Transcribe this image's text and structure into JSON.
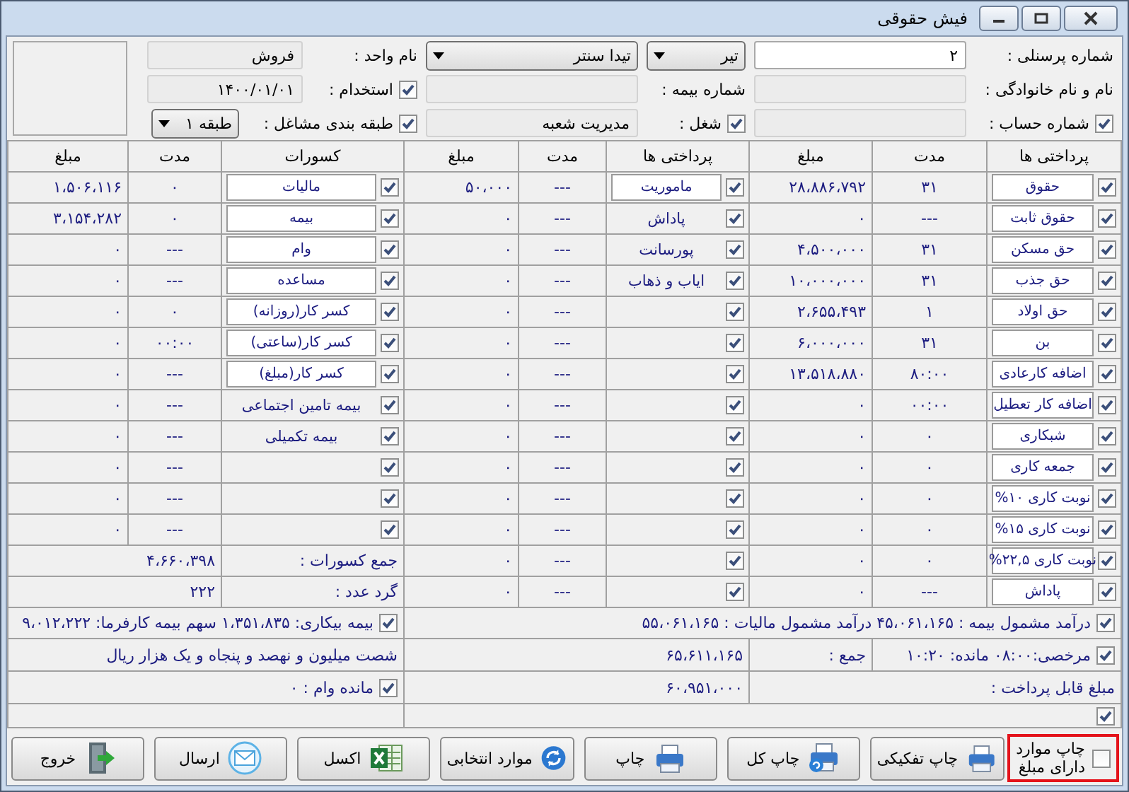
{
  "window": {
    "title": "فیش حقوقی"
  },
  "header": {
    "personnel_no": {
      "label": "شماره پرسنلی :",
      "value": "۲",
      "disabled": false
    },
    "month": {
      "value": "تیر"
    },
    "company": {
      "value": "تیدا سنتر"
    },
    "unit": {
      "label": "نام واحد :",
      "value": "فروش",
      "disabled": true
    },
    "full_name": {
      "label": "نام و نام خانوادگی :",
      "disabled": true
    },
    "insurance_no": {
      "label": "شماره بیمه :",
      "disabled": true
    },
    "employment": {
      "label": "استخدام :",
      "checked": true,
      "value": "۱۴۰۰/۰۱/۰۱",
      "disabled": true
    },
    "account": {
      "label": "شماره حساب :",
      "checked": true,
      "disabled": true
    },
    "job": {
      "label": "شغل :",
      "checked": true,
      "value": "مدیریت شعبه",
      "disabled": true
    },
    "job_class": {
      "label": "طبقه بندی مشاغل :",
      "checked": true,
      "value": "طبقه ۱"
    }
  },
  "columns": [
    "پرداختی ها",
    "مدت",
    "مبلغ",
    "پرداختی ها",
    "مدت",
    "مبلغ",
    "کسورات",
    "مدت",
    "مبلغ"
  ],
  "payments": [
    {
      "label": "حقوق",
      "kind": "field",
      "checked": true,
      "duration": "۳۱",
      "amount": "۲۸،۸۸۶،۷۹۲"
    },
    {
      "label": "حقوق ثابت",
      "kind": "field",
      "checked": true,
      "duration": "---",
      "amount": "۰"
    },
    {
      "label": "حق مسکن",
      "kind": "field",
      "checked": true,
      "duration": "۳۱",
      "amount": "۴،۵۰۰،۰۰۰"
    },
    {
      "label": "حق جذب",
      "kind": "field",
      "checked": true,
      "duration": "۳۱",
      "amount": "۱۰،۰۰۰،۰۰۰"
    },
    {
      "label": "حق اولاد",
      "kind": "field",
      "checked": true,
      "duration": "۱",
      "amount": "۲،۶۵۵،۴۹۳"
    },
    {
      "label": "بن",
      "kind": "field",
      "checked": true,
      "duration": "۳۱",
      "amount": "۶،۰۰۰،۰۰۰"
    },
    {
      "label": "اضافه کارعادی",
      "kind": "field",
      "checked": true,
      "duration": "۸۰:۰۰",
      "amount": "۱۳،۵۱۸،۸۸۰"
    },
    {
      "label": "اضافه کار تعطیل",
      "kind": "field",
      "checked": true,
      "duration": "۰۰:۰۰",
      "amount": "۰"
    },
    {
      "label": "شبکاری",
      "kind": "field",
      "checked": true,
      "duration": "۰",
      "amount": "۰"
    },
    {
      "label": "جمعه کاری",
      "kind": "field",
      "checked": true,
      "duration": "۰",
      "amount": "۰"
    },
    {
      "label": "نوبت کاری ۱۰%",
      "kind": "field",
      "checked": true,
      "duration": "۰",
      "amount": "۰"
    },
    {
      "label": "نوبت کاری ۱۵%",
      "kind": "field",
      "checked": true,
      "duration": "۰",
      "amount": "۰"
    },
    {
      "label": "نوبت کاری ۲۲,۵%",
      "kind": "field",
      "checked": true,
      "duration": "۰",
      "amount": "۰"
    },
    {
      "label": "پاداش",
      "kind": "field",
      "checked": true,
      "duration": "---",
      "amount": "۰"
    }
  ],
  "other_payments": [
    {
      "label": "ماموریت",
      "kind": "field",
      "checked": true,
      "duration": "---",
      "amount": "۵۰،۰۰۰"
    },
    {
      "label": "پاداش",
      "kind": "plain",
      "checked": true,
      "duration": "---",
      "amount": "۰"
    },
    {
      "label": "پورسانت",
      "kind": "plain",
      "checked": true,
      "duration": "---",
      "amount": "۰"
    },
    {
      "label": "ایاب و ذهاب",
      "kind": "plain",
      "checked": true,
      "duration": "---",
      "amount": "۰"
    },
    {
      "kind": "plain",
      "checked": true,
      "duration": "---",
      "amount": "۰"
    },
    {
      "kind": "plain",
      "checked": true,
      "duration": "---",
      "amount": "۰"
    },
    {
      "kind": "plain",
      "checked": true,
      "duration": "---",
      "amount": "۰"
    },
    {
      "kind": "plain",
      "checked": true,
      "duration": "---",
      "amount": "۰"
    },
    {
      "kind": "plain",
      "checked": true,
      "duration": "---",
      "amount": "۰"
    },
    {
      "kind": "plain",
      "checked": true,
      "duration": "---",
      "amount": "۰"
    },
    {
      "kind": "plain",
      "checked": true,
      "duration": "---",
      "amount": "۰"
    },
    {
      "kind": "plain",
      "checked": true,
      "duration": "---",
      "amount": "۰"
    },
    {
      "kind": "plain",
      "checked": true,
      "duration": "---",
      "amount": "۰"
    },
    {
      "kind": "plain",
      "checked": true,
      "duration": "---",
      "amount": "۰"
    }
  ],
  "deductions": [
    {
      "label": "مالیات",
      "kind": "field",
      "checked": true,
      "duration": "۰",
      "amount": "۱،۵۰۶،۱۱۶"
    },
    {
      "label": "بیمه",
      "kind": "field",
      "checked": true,
      "duration": "۰",
      "amount": "۳،۱۵۴،۲۸۲"
    },
    {
      "label": "وام",
      "kind": "field",
      "checked": true,
      "duration": "---",
      "amount": "۰"
    },
    {
      "label": "مساعده",
      "kind": "field",
      "checked": true,
      "duration": "---",
      "amount": "۰"
    },
    {
      "label": "کسر کار(روزانه)",
      "kind": "field",
      "checked": true,
      "duration": "۰",
      "amount": "۰"
    },
    {
      "label": "کسر کار(ساعتی)",
      "kind": "field",
      "checked": true,
      "duration": "۰۰:۰۰",
      "amount": "۰"
    },
    {
      "label": "کسر کار(مبلغ)",
      "kind": "field",
      "checked": true,
      "duration": "---",
      "amount": "۰"
    },
    {
      "label": "بیمه تامین اجتماعی",
      "kind": "plain",
      "checked": true,
      "duration": "---",
      "amount": "۰"
    },
    {
      "label": "بیمه تکمیلی",
      "kind": "plain",
      "checked": true,
      "duration": "---",
      "amount": "۰"
    },
    {
      "kind": "plain",
      "checked": true,
      "duration": "---",
      "amount": "۰"
    },
    {
      "kind": "plain",
      "checked": true,
      "duration": "---",
      "amount": "۰"
    },
    {
      "kind": "plain",
      "checked": true,
      "duration": "---",
      "amount": "۰"
    }
  ],
  "deduction_totals": [
    {
      "label": "جمع کسورات :",
      "value": "۴،۶۶۰،۳۹۸"
    },
    {
      "label": "گرد عدد :",
      "value": "۲۲۲"
    }
  ],
  "summary": {
    "taxable_income": {
      "checked": true,
      "text": "درآمد مشمول بیمه : ۴۵،۰۶۱،۱۶۵ درآمد مشمول مالیات : ۵۵،۰۶۱،۱۶۵"
    },
    "unemployment": {
      "checked": true,
      "text": "بیمه بیکاری: ۱،۳۵۱،۸۳۵ سهم بیمه کارفرما: ۹،۰۱۲،۲۲۲"
    },
    "leave": {
      "checked": true,
      "text": "مرخصی:۰۸:۰۰ مانده: ۱۰:۲۰"
    },
    "total": {
      "label": "جمع :",
      "value": "۶۵،۶۱۱،۱۶۵"
    },
    "in_words": "شصت میلیون و نهصد و پنجاه و یک هزار ریال",
    "payable": {
      "label": "مبلغ قابل پرداخت :",
      "value": "۶۰،۹۵۱،۰۰۰"
    },
    "loan_balance": {
      "checked": true,
      "text": "مانده وام : ۰"
    },
    "extra": {
      "checked": true
    }
  },
  "print_option": {
    "label": "چاپ موارد دارای مبلغ",
    "checked": false
  },
  "buttons": [
    {
      "label": "چاپ تفکیکی",
      "kind": "printer"
    },
    {
      "label": "چاپ کل",
      "kind": "printer_refresh"
    },
    {
      "label": "چاپ",
      "kind": "printer"
    },
    {
      "label": "موارد انتخابی",
      "kind": "refresh"
    },
    {
      "label": "اکسل",
      "kind": "spreadsheet"
    },
    {
      "label": "ارسال",
      "kind": "envelope"
    },
    {
      "label": "خروج",
      "kind": "exit"
    }
  ]
}
